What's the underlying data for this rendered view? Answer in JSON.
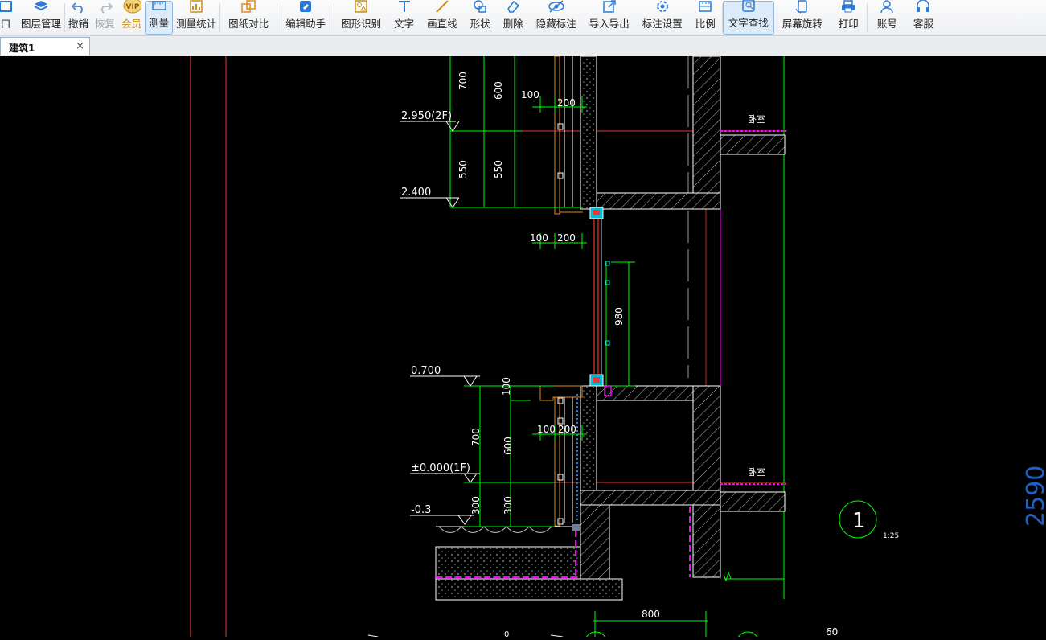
{
  "toolbar": {
    "items": [
      {
        "label": "口",
        "icon": "window-icon"
      },
      {
        "label": "图层管理",
        "icon": "layers-icon"
      },
      {
        "label": "撤销",
        "icon": "undo-icon"
      },
      {
        "label": "恢复",
        "icon": "redo-icon"
      },
      {
        "label": "会员",
        "icon": "vip-icon"
      },
      {
        "label": "测量",
        "icon": "measure-icon"
      },
      {
        "label": "测量统计",
        "icon": "measure-stats-icon"
      },
      {
        "label": "图纸对比",
        "icon": "compare-icon"
      },
      {
        "label": "编辑助手",
        "icon": "edit-assistant-icon"
      },
      {
        "label": "图形识别",
        "icon": "shape-recognition-icon"
      },
      {
        "label": "文字",
        "icon": "text-icon"
      },
      {
        "label": "画直线",
        "icon": "line-icon"
      },
      {
        "label": "形状",
        "icon": "shape-icon"
      },
      {
        "label": "删除",
        "icon": "eraser-icon"
      },
      {
        "label": "隐藏标注",
        "icon": "hide-annotation-icon"
      },
      {
        "label": "导入导出",
        "icon": "import-export-icon"
      },
      {
        "label": "标注设置",
        "icon": "annotation-settings-icon"
      },
      {
        "label": "比例",
        "icon": "scale-icon"
      },
      {
        "label": "文字查找",
        "icon": "text-search-icon"
      },
      {
        "label": "屏幕旋转",
        "icon": "rotate-screen-icon"
      },
      {
        "label": "打印",
        "icon": "print-icon"
      },
      {
        "label": "账号",
        "icon": "account-icon"
      },
      {
        "label": "客服",
        "icon": "support-icon"
      }
    ],
    "vip_badge": "VIP",
    "active_items": [
      "测量",
      "文字查找"
    ]
  },
  "tabs": [
    {
      "label": "建筑1",
      "close": "×"
    }
  ],
  "drawing": {
    "levels": [
      "2.950(2F)",
      "2.400",
      "0.700",
      "±0.000(1F)",
      "-0.3"
    ],
    "dims_left_outer": [
      "700",
      "550",
      "700",
      "300"
    ],
    "dims_left_inner": [
      "600",
      "550",
      "100",
      "600",
      "300"
    ],
    "dims_horizontal": [
      "100",
      "200",
      "100",
      "200",
      "100",
      "200",
      "800",
      "60"
    ],
    "dim_vertical_window": "980",
    "room_labels": [
      "卧室",
      "卧室"
    ],
    "section_marker": "1",
    "section_scale": "1:25",
    "edge_text": "2590",
    "bottom_partial": "0",
    "colors": {
      "background": "#000000",
      "dimension": "#00ff00",
      "red_line": "#e53935",
      "magenta": "#ff00ff",
      "hatch": "#cfcfcf",
      "white": "#ffffff",
      "cyan": "#00e5ff"
    }
  }
}
